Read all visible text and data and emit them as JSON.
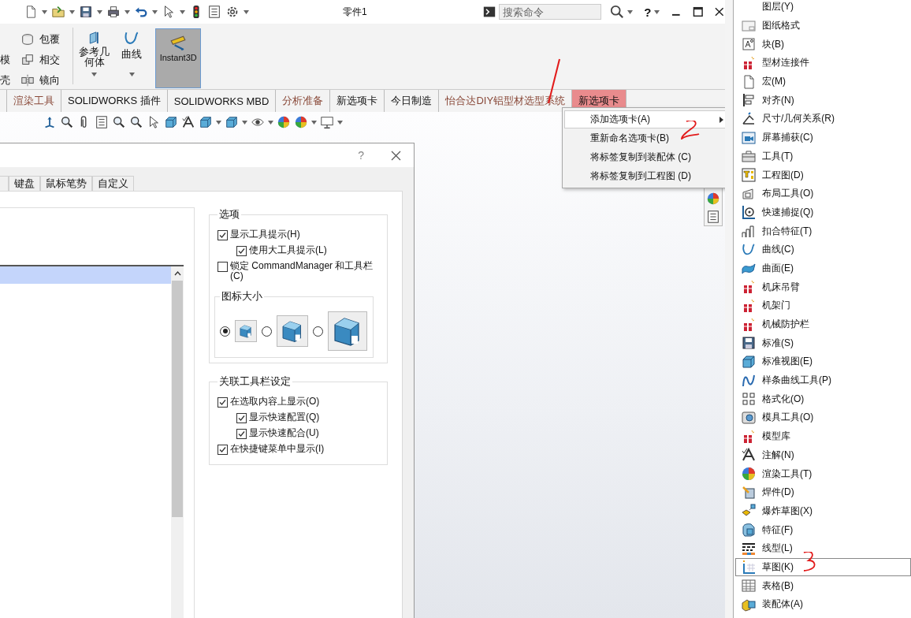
{
  "title_bar": {
    "title": "零件1",
    "search": {
      "placeholder": "搜索命令"
    },
    "help": "?"
  },
  "ribbon": {
    "cut_labels": [
      "模",
      "壳"
    ],
    "tools": [
      {
        "label": "包覆"
      },
      {
        "label": "相交"
      },
      {
        "label": "镜向"
      }
    ],
    "large_tools": [
      {
        "label": "参考几何体",
        "dropdown": true,
        "selected": false
      },
      {
        "label": "曲线",
        "dropdown": true,
        "selected": false
      },
      {
        "label": "Instant3D",
        "dropdown": false,
        "selected": true
      }
    ]
  },
  "tabs": [
    {
      "label": "渲染工具",
      "kind": "addin",
      "selected": false
    },
    {
      "label": "SOLIDWORKS 插件",
      "kind": "standard",
      "selected": false
    },
    {
      "label": "SOLIDWORKS MBD",
      "kind": "standard",
      "selected": false
    },
    {
      "label": "分析准备",
      "kind": "addin",
      "selected": false
    },
    {
      "label": "新选项卡",
      "kind": "standard",
      "selected": false
    },
    {
      "label": "今日制造",
      "kind": "standard",
      "selected": false
    },
    {
      "label": "怡合达DIY铝型材选型系统",
      "kind": "addin",
      "selected": false
    },
    {
      "label": "新选项卡",
      "kind": "standard",
      "selected": true
    }
  ],
  "context_menu": {
    "items": [
      {
        "label": "添加选项卡(A)",
        "submenu": true,
        "selected": true
      },
      {
        "label": "重新命名选项卡(B)",
        "submenu": false,
        "selected": false
      },
      {
        "label": "将标签复制到装配体 (C)",
        "submenu": false,
        "selected": false
      },
      {
        "label": "将标签复制到工程图 (D)",
        "submenu": false,
        "selected": false
      }
    ]
  },
  "dialog": {
    "help": "?",
    "tabs": [
      {
        "label": "键盘",
        "selected": false
      },
      {
        "label": "鼠标笔势",
        "selected": false
      },
      {
        "label": "自定义",
        "selected": false
      }
    ],
    "list": {
      "rows": [
        {
          "selected": true
        }
      ]
    },
    "options": {
      "title": "选项",
      "checkboxes": [
        {
          "label": "显示工具提示(H)",
          "checked": true,
          "children": [
            {
              "label": "使用大工具提示(L)",
              "checked": true
            }
          ]
        },
        {
          "label": "锁定 CommandManager 和工具栏(C)",
          "checked": false
        }
      ]
    },
    "icon_size": {
      "title": "图标大小",
      "options": [
        {
          "selected": true
        },
        {
          "selected": false
        },
        {
          "selected": false
        }
      ]
    },
    "context_toolbar": {
      "title": "关联工具栏设定",
      "checkboxes": [
        {
          "label": "在选取内容上显示(O)",
          "checked": true,
          "children": [
            {
              "label": "显示快速配置(Q)",
              "checked": true
            },
            {
              "label": "显示快速配合(U)",
              "checked": true
            }
          ]
        },
        {
          "label": "在快捷键菜单中显示(I)",
          "checked": true
        }
      ]
    }
  },
  "toolbar_list": {
    "items": [
      {
        "label": "图层(Y)",
        "selected": false
      },
      {
        "label": "图纸格式",
        "selected": false
      },
      {
        "label": "块(B)",
        "selected": false
      },
      {
        "label": "型材连接件",
        "selected": false
      },
      {
        "label": "宏(M)",
        "selected": false
      },
      {
        "label": "对齐(N)",
        "selected": false
      },
      {
        "label": "尺寸/几何关系(R)",
        "selected": false
      },
      {
        "label": "屏幕捕获(C)",
        "selected": false
      },
      {
        "label": "工具(T)",
        "selected": false
      },
      {
        "label": "工程图(D)",
        "selected": false
      },
      {
        "label": "布局工具(O)",
        "selected": false
      },
      {
        "label": "快速捕捉(Q)",
        "selected": false
      },
      {
        "label": "扣合特征(T)",
        "selected": false
      },
      {
        "label": "曲线(C)",
        "selected": false
      },
      {
        "label": "曲面(E)",
        "selected": false
      },
      {
        "label": "机床吊臂",
        "selected": false
      },
      {
        "label": "机架门",
        "selected": false
      },
      {
        "label": "机械防护栏",
        "selected": false
      },
      {
        "label": "标准(S)",
        "selected": false
      },
      {
        "label": "标准视图(E)",
        "selected": false
      },
      {
        "label": "样条曲线工具(P)",
        "selected": false
      },
      {
        "label": "格式化(O)",
        "selected": false
      },
      {
        "label": "模具工具(O)",
        "selected": false
      },
      {
        "label": "模型库",
        "selected": false
      },
      {
        "label": "注解(N)",
        "selected": false
      },
      {
        "label": "渲染工具(T)",
        "selected": false
      },
      {
        "label": "焊件(D)",
        "selected": false
      },
      {
        "label": "爆炸草图(X)",
        "selected": false
      },
      {
        "label": "特征(F)",
        "selected": false
      },
      {
        "label": "线型(L)",
        "selected": false
      },
      {
        "label": "草图(K)",
        "selected": true
      },
      {
        "label": "表格(B)",
        "selected": false
      },
      {
        "label": "装配体(A)",
        "selected": false
      }
    ]
  }
}
